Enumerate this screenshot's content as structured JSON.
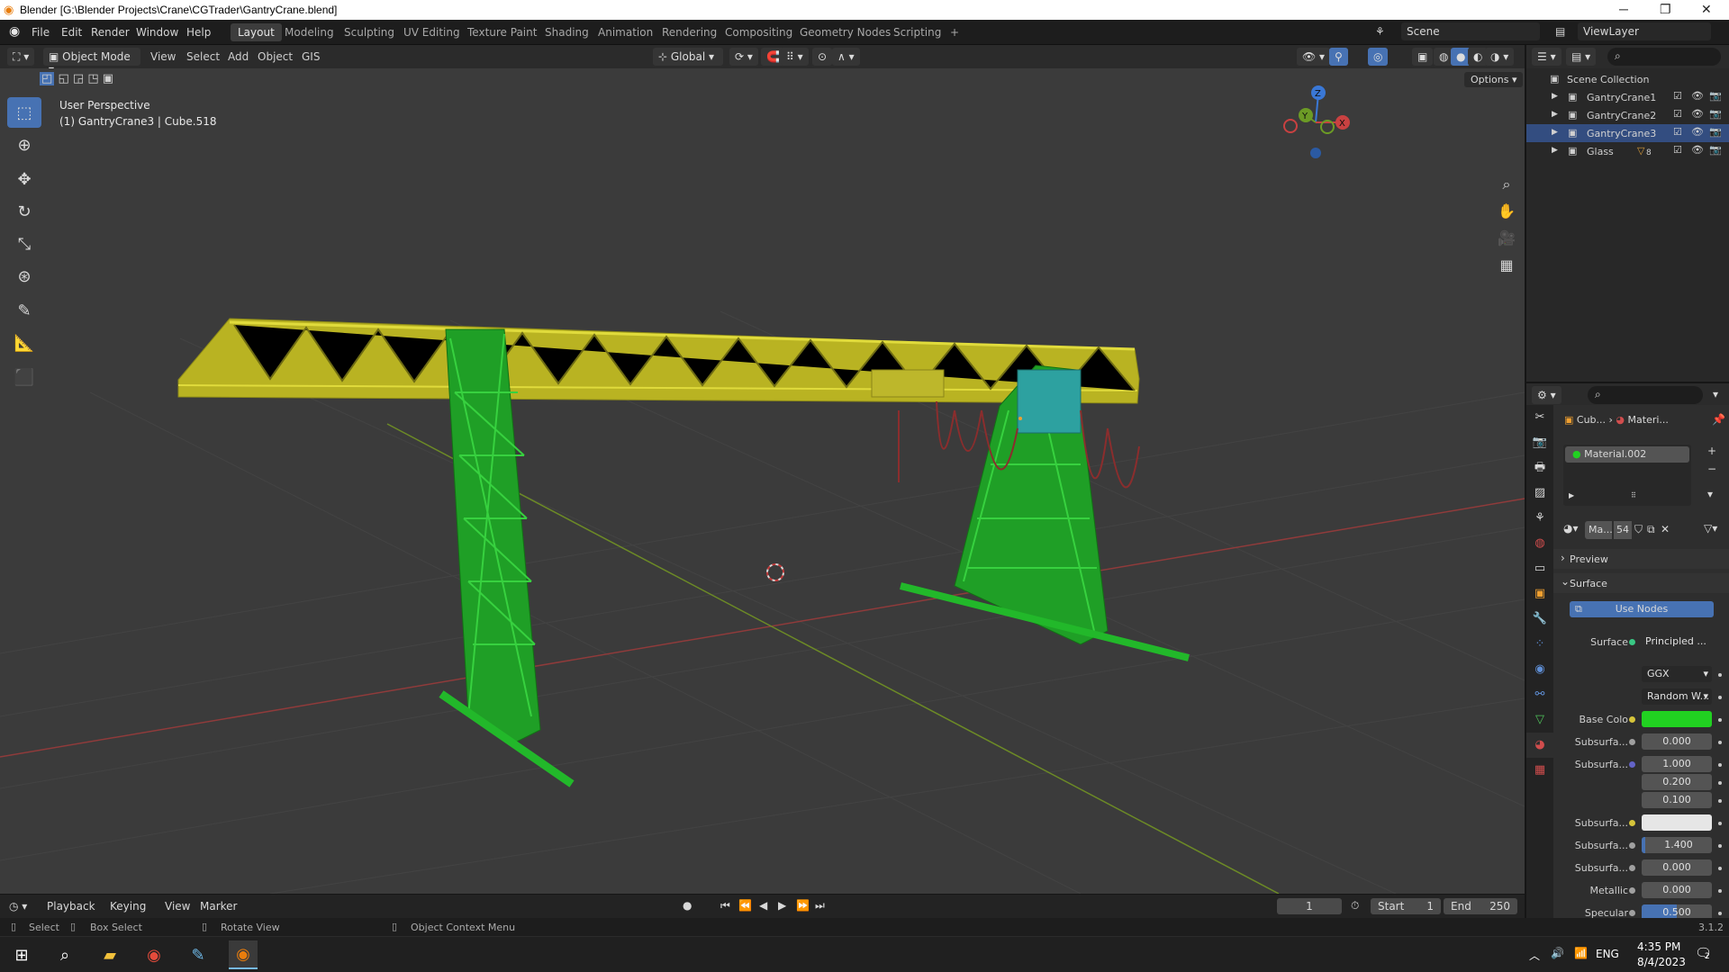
{
  "window": {
    "title": "Blender [G:\\Blender Projects\\Crane\\CGTrader\\GantryCrane.blend]",
    "minimize": "─",
    "maximize": "❐",
    "close": "✕"
  },
  "menu": [
    "File",
    "Edit",
    "Render",
    "Window",
    "Help"
  ],
  "workspaces": [
    "Layout",
    "Modeling",
    "Sculpting",
    "UV Editing",
    "Texture Paint",
    "Shading",
    "Animation",
    "Rendering",
    "Compositing",
    "Geometry Nodes",
    "Scripting"
  ],
  "add_workspace": "+",
  "scene": "Scene",
  "view_layer": "ViewLayer",
  "viewport_header": {
    "mode": "Object Mode",
    "menus": [
      "View",
      "Select",
      "Add",
      "Object",
      "GIS"
    ],
    "orientation": "Global",
    "options": "Options"
  },
  "viewport": {
    "perspective": "User Perspective",
    "object_info": "(1) GantryCrane3 | Cube.518",
    "gizmo": {
      "z": "Z",
      "y": "Y",
      "x": "X"
    }
  },
  "outliner": {
    "root": "Scene Collection",
    "items": [
      {
        "label": "GantryCrane1",
        "selected": false
      },
      {
        "label": "GantryCrane2",
        "selected": false
      },
      {
        "label": "GantryCrane3",
        "selected": true
      },
      {
        "label": "Glass",
        "selected": false,
        "badge": "8"
      }
    ]
  },
  "properties": {
    "breadcrumb": [
      "Cub...",
      "Materi..."
    ],
    "material_slot": "Material.002",
    "material_name": "Ma...",
    "user_count": "54",
    "sections": {
      "preview": "Preview",
      "surface": "Surface"
    },
    "use_nodes": "Use Nodes",
    "surface_label": "Surface",
    "surface_value": "Principled ...",
    "distribution": "GGX",
    "subsurface_method": "Random W...",
    "rows": [
      {
        "label": "Base Colo",
        "value": "",
        "color": "#21d121",
        "dot": "#d6c43a"
      },
      {
        "label": "Subsurfa...",
        "value": "0.000",
        "dot": "#a0a0a0"
      },
      {
        "label": "Subsurfa...",
        "value": "1.000",
        "dot": "#6363c7"
      },
      {
        "label": "",
        "value": "0.200"
      },
      {
        "label": "",
        "value": "0.100"
      },
      {
        "label": "Subsurfa...",
        "value": "",
        "color": "#e6e6e6",
        "dot": "#d6c43a"
      },
      {
        "label": "Subsurfa...",
        "value": "1.400",
        "dot": "#a0a0a0"
      },
      {
        "label": "Subsurfa...",
        "value": "0.000",
        "dot": "#a0a0a0"
      },
      {
        "label": "Metallic",
        "value": "0.000",
        "dot": "#a0a0a0"
      },
      {
        "label": "Specular",
        "value": "0.500",
        "dot": "#a0a0a0"
      }
    ]
  },
  "timeline": {
    "menus": [
      "Playback",
      "Keying",
      "View",
      "Marker"
    ],
    "current_frame": "1",
    "start_label": "Start",
    "start": "1",
    "end_label": "End",
    "end": "250"
  },
  "statusbar": {
    "select": "Select",
    "box_select": "Box Select",
    "rotate": "Rotate View",
    "context": "Object Context Menu",
    "version": "3.1.2"
  },
  "taskbar": {
    "language": "ENG",
    "time": "4:35 PM",
    "date": "8/4/2023",
    "notifications": "2"
  },
  "colors": {
    "accent": "#4772b3",
    "crane_beam": "#c4c024",
    "crane_legs": "#22b82a",
    "x_axis": "#c23b3b",
    "y_axis": "#7ea22a"
  }
}
